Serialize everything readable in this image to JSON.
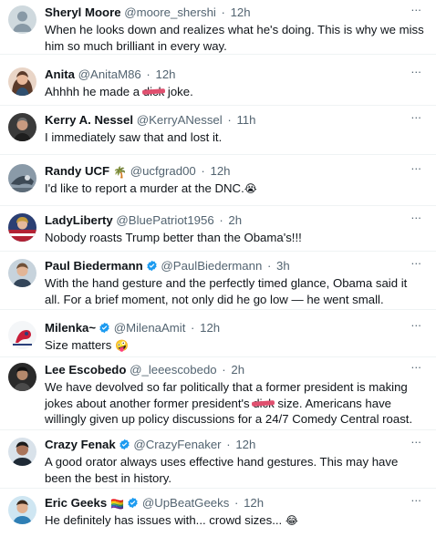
{
  "replies": [
    {
      "name": "Sheryl Moore",
      "handle": "@moore_shershi",
      "separator": "·",
      "time": "12h",
      "more": "···",
      "text_a": "When he looks down and realizes what he's doing. This is why we miss him so much brilliant in every way."
    },
    {
      "name": "Anita",
      "handle": "@AnitaM86",
      "separator": "·",
      "time": "12h",
      "more": "···",
      "text_a": "Ahhhh he made a ",
      "text_censored": "dick",
      "text_b": " joke."
    },
    {
      "name": "Kerry A. Nessel",
      "handle": "@KerryANessel",
      "separator": "·",
      "time": "11h",
      "more": "···",
      "text_a": "I immediately saw that and lost it."
    },
    {
      "name": "Randy UCF",
      "flag": "🌴",
      "handle": "@ucfgrad00",
      "separator": "·",
      "time": "12h",
      "more": "···",
      "text_a": "I'd like to report a murder at the DNC.",
      "emoji": "😭"
    },
    {
      "name": "LadyLiberty",
      "handle": "@BluePatriot1956",
      "separator": "·",
      "time": "2h",
      "more": "···",
      "text_a": "Nobody roasts Trump better than the Obama's!!!"
    },
    {
      "name": "Paul Biedermann",
      "handle": "@PaulBiedermann",
      "separator": "·",
      "time": "3h",
      "more": "···",
      "text_a": "With the hand gesture and the perfectly timed glance, Obama said it all. For a brief moment, not only did he go low — he went small."
    },
    {
      "name": "Milenka~",
      "handle": "@MilenaAmit",
      "separator": "·",
      "time": "12h",
      "more": "···",
      "text_a": "Size matters ",
      "emoji": "🤪"
    },
    {
      "name": "Lee Escobedo",
      "handle": "@_leeescobedo",
      "separator": "·",
      "time": "2h",
      "more": "···",
      "text_a": "We have devolved so far politically that a former president is making jokes about another former president's ",
      "text_censored": "dick",
      "text_b": " size. Americans have willingly given up policy discussions for a 24/7 Comedy Central roast."
    },
    {
      "name": "Crazy Fenak",
      "handle": "@CrazyFenaker",
      "separator": "·",
      "time": "12h",
      "more": "···",
      "text_a": "A good orator always uses effective hand gestures. This may have been the best in history."
    },
    {
      "name": "Eric Geeks",
      "flag": "🏳️‍🌈",
      "handle": "@UpBeatGeeks",
      "separator": "·",
      "time": "12h",
      "more": "···",
      "text_a": "He definitely has issues with... crowd sizes... ",
      "emoji": "😂"
    }
  ],
  "colors": {
    "text": "#0f1419",
    "muted": "#536471",
    "verified": "#1d9bf0",
    "censor": "#e0506f",
    "divider": "#eff3f4"
  },
  "icons": {
    "verified": "verified-badge-icon",
    "more": "more-options-icon"
  }
}
